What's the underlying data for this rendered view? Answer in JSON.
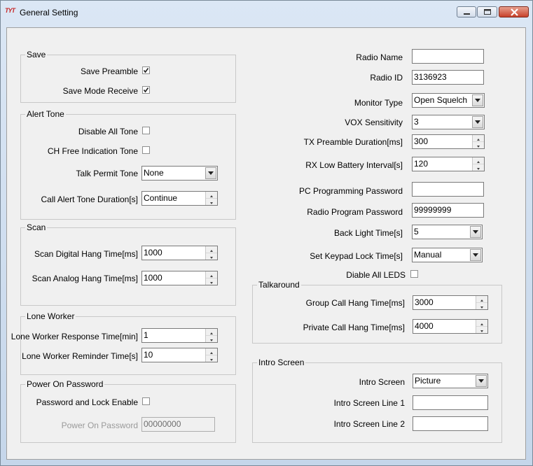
{
  "window": {
    "title": "General Setting"
  },
  "save": {
    "legend": "Save",
    "save_preamble": {
      "label": "Save Preamble",
      "checked": true
    },
    "save_mode_receive": {
      "label": "Save Mode Receive",
      "checked": true
    }
  },
  "alert_tone": {
    "legend": "Alert Tone",
    "disable_all_tone": {
      "label": "Disable All Tone",
      "checked": false
    },
    "ch_free_indication_tone": {
      "label": "CH Free Indication Tone",
      "checked": false
    },
    "talk_permit_tone": {
      "label": "Talk Permit Tone",
      "value": "None"
    },
    "call_alert_tone_duration": {
      "label": "Call Alert Tone Duration[s]",
      "value": "Continue"
    }
  },
  "scan": {
    "legend": "Scan",
    "scan_digital_hang_time": {
      "label": "Scan Digital Hang Time[ms]",
      "value": "1000"
    },
    "scan_analog_hang_time": {
      "label": "Scan Analog Hang Time[ms]",
      "value": "1000"
    }
  },
  "lone_worker": {
    "legend": "Lone Worker",
    "response_time": {
      "label": "Lone Worker Response Time[min]",
      "value": "1"
    },
    "reminder_time": {
      "label": "Lone Worker Reminder Time[s]",
      "value": "10"
    }
  },
  "power_on_password": {
    "legend": "Power On Password",
    "password_and_lock_enable": {
      "label": "Password and Lock Enable",
      "checked": false
    },
    "power_on_password": {
      "label": "Power On Password",
      "value": "00000000"
    }
  },
  "right": {
    "radio_name": {
      "label": "Radio Name",
      "value": ""
    },
    "radio_id": {
      "label": "Radio ID",
      "value": "3136923"
    },
    "monitor_type": {
      "label": "Monitor Type",
      "value": "Open Squelch"
    },
    "vox_sensitivity": {
      "label": "VOX Sensitivity",
      "value": "3"
    },
    "tx_preamble_duration": {
      "label": "TX Preamble Duration[ms]",
      "value": "300"
    },
    "rx_low_battery_interval": {
      "label": "RX Low Battery Interval[s]",
      "value": "120"
    },
    "pc_programming_password": {
      "label": "PC Programming Password",
      "value": ""
    },
    "radio_program_password": {
      "label": "Radio Program Password",
      "value": "99999999"
    },
    "back_light_time": {
      "label": "Back Light Time[s]",
      "value": "5"
    },
    "set_keypad_lock_time": {
      "label": "Set Keypad Lock Time[s]",
      "value": "Manual"
    },
    "disable_all_leds": {
      "label": "Diable All LEDS",
      "checked": false
    }
  },
  "talkaround": {
    "legend": "Talkaround",
    "group_call_hang_time": {
      "label": "Group Call Hang Time[ms]",
      "value": "3000"
    },
    "private_call_hang_time": {
      "label": "Private Call Hang Time[ms]",
      "value": "4000"
    }
  },
  "intro_screen": {
    "legend": "Intro Screen",
    "intro_screen": {
      "label": "Intro Screen",
      "value": "Picture"
    },
    "line1": {
      "label": "Intro Screen Line 1",
      "value": ""
    },
    "line2": {
      "label": "Intro Screen Line 2",
      "value": ""
    }
  }
}
